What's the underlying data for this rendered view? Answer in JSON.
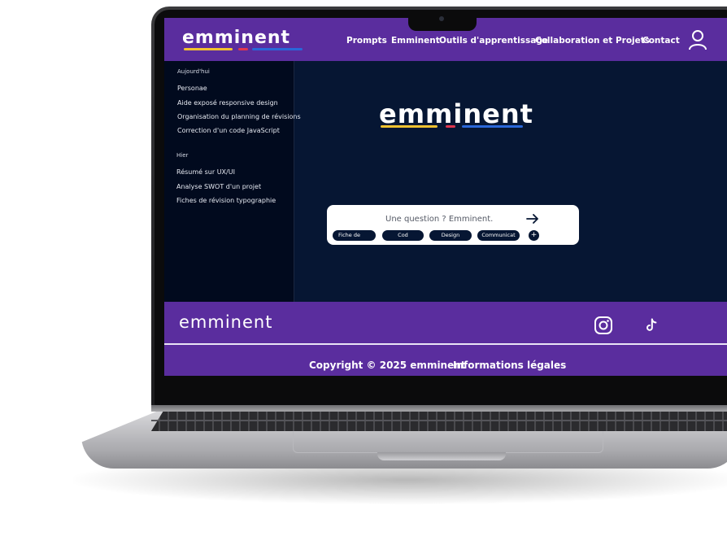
{
  "brand": {
    "name": "emminent",
    "colors": {
      "purple": "#5a2d9e",
      "navy": "#061633",
      "logo_yellow": "#f2c230",
      "logo_red": "#e0374f",
      "logo_blue": "#2a67d8"
    }
  },
  "header": {
    "nav": [
      "Prompts",
      "Emminent",
      "Outils d'apprentissage",
      "Collaboration et Projets",
      "Contact"
    ],
    "account_icon": "user-icon"
  },
  "sidebar": {
    "today": {
      "heading": "Aujourd'hui",
      "items": [
        "Personae",
        "Aide  exposé responsive design",
        "Organisation du planning de révisions",
        "Correction d'un code JavaScript"
      ]
    },
    "yesterday": {
      "heading": "Hier",
      "items": [
        "Résumé sur UX/UI",
        "Analyse SWOT d'un projet",
        "Fiches de révision typographie"
      ]
    }
  },
  "main": {
    "prompt": {
      "placeholder": "Une question ? Emminent.",
      "send_icon": "arrow-right-icon",
      "chips": [
        "Fiche de",
        "Cod",
        "Design",
        "Communicat"
      ],
      "add_icon": "plus-icon"
    }
  },
  "footer": {
    "social_icons": [
      "instagram-icon",
      "tiktok-icon"
    ],
    "copyright": "Copyright © 2025 emminent",
    "legal": "Informations légales"
  }
}
